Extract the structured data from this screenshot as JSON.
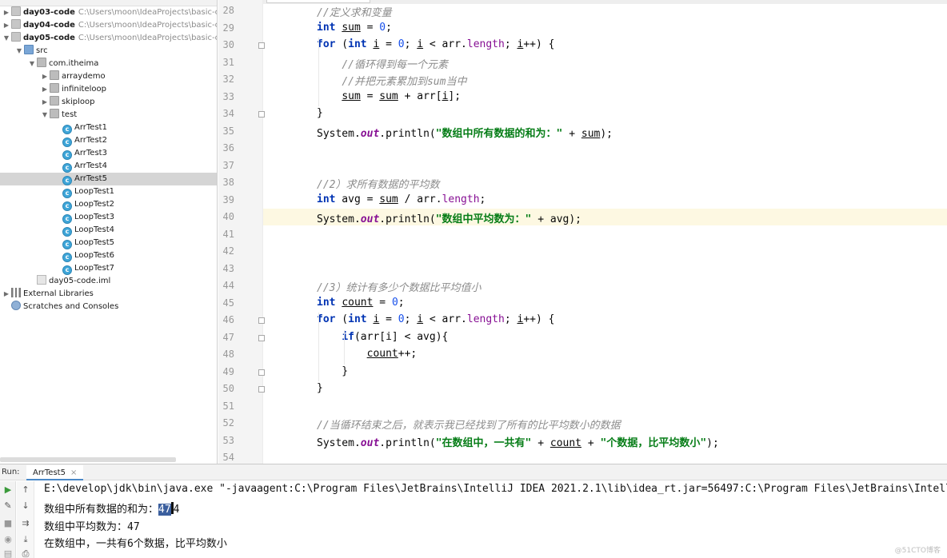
{
  "tree": {
    "rows": [
      {
        "label": "day03-code",
        "path": "C:\\Users\\moon\\IdeaProjects\\basic-code",
        "indent": 0,
        "arrow": "▶",
        "icon": "folder",
        "bold": true
      },
      {
        "label": "day04-code",
        "path": "C:\\Users\\moon\\IdeaProjects\\basic-code",
        "indent": 0,
        "arrow": "▶",
        "icon": "folder",
        "bold": true
      },
      {
        "label": "day05-code",
        "path": "C:\\Users\\moon\\IdeaProjects\\basic-code",
        "indent": 0,
        "arrow": "▼",
        "icon": "folder",
        "bold": true
      },
      {
        "label": "src",
        "path": "",
        "indent": 1,
        "arrow": "▼",
        "icon": "srcfolder",
        "bold": false
      },
      {
        "label": "com.itheima",
        "path": "",
        "indent": 2,
        "arrow": "▼",
        "icon": "pkg",
        "bold": false
      },
      {
        "label": "arraydemo",
        "path": "",
        "indent": 3,
        "arrow": "▶",
        "icon": "pkg",
        "bold": false
      },
      {
        "label": "infiniteloop",
        "path": "",
        "indent": 3,
        "arrow": "▶",
        "icon": "pkg",
        "bold": false
      },
      {
        "label": "skiploop",
        "path": "",
        "indent": 3,
        "arrow": "▶",
        "icon": "pkg",
        "bold": false
      },
      {
        "label": "test",
        "path": "",
        "indent": 3,
        "arrow": "▼",
        "icon": "pkg",
        "bold": false
      },
      {
        "label": "ArrTest1",
        "path": "",
        "indent": 4,
        "arrow": "",
        "icon": "cls",
        "bold": false
      },
      {
        "label": "ArrTest2",
        "path": "",
        "indent": 4,
        "arrow": "",
        "icon": "cls",
        "bold": false
      },
      {
        "label": "ArrTest3",
        "path": "",
        "indent": 4,
        "arrow": "",
        "icon": "cls",
        "bold": false
      },
      {
        "label": "ArrTest4",
        "path": "",
        "indent": 4,
        "arrow": "",
        "icon": "cls",
        "bold": false
      },
      {
        "label": "ArrTest5",
        "path": "",
        "indent": 4,
        "arrow": "",
        "icon": "cls",
        "bold": false,
        "selected": true
      },
      {
        "label": "LoopTest1",
        "path": "",
        "indent": 4,
        "arrow": "",
        "icon": "cls",
        "bold": false
      },
      {
        "label": "LoopTest2",
        "path": "",
        "indent": 4,
        "arrow": "",
        "icon": "cls",
        "bold": false
      },
      {
        "label": "LoopTest3",
        "path": "",
        "indent": 4,
        "arrow": "",
        "icon": "cls",
        "bold": false
      },
      {
        "label": "LoopTest4",
        "path": "",
        "indent": 4,
        "arrow": "",
        "icon": "cls",
        "bold": false
      },
      {
        "label": "LoopTest5",
        "path": "",
        "indent": 4,
        "arrow": "",
        "icon": "cls",
        "bold": false
      },
      {
        "label": "LoopTest6",
        "path": "",
        "indent": 4,
        "arrow": "",
        "icon": "cls",
        "bold": false
      },
      {
        "label": "LoopTest7",
        "path": "",
        "indent": 4,
        "arrow": "",
        "icon": "cls",
        "bold": false
      },
      {
        "label": "day05-code.iml",
        "path": "",
        "indent": 2,
        "arrow": "",
        "icon": "iml",
        "bold": false
      },
      {
        "label": "External Libraries",
        "path": "",
        "indent": 0,
        "arrow": "▶",
        "icon": "lib",
        "bold": false
      },
      {
        "label": "Scratches and Consoles",
        "path": "",
        "indent": 0,
        "arrow": "",
        "icon": "scratch",
        "bold": false
      }
    ]
  },
  "editor": {
    "current_line": 40,
    "lines": [
      {
        "n": 28,
        "code": [
          {
            "t": "//定义求和变量",
            "c": "cm"
          }
        ]
      },
      {
        "n": 29,
        "code": [
          {
            "t": "int",
            "c": "kw"
          },
          {
            "t": " "
          },
          {
            "t": "sum",
            "c": "ul"
          },
          {
            "t": " = "
          },
          {
            "t": "0",
            "c": "num"
          },
          {
            "t": ";"
          }
        ]
      },
      {
        "n": 30,
        "code": [
          {
            "t": "for",
            "c": "kw"
          },
          {
            "t": " ("
          },
          {
            "t": "int",
            "c": "kw"
          },
          {
            "t": " "
          },
          {
            "t": "i",
            "c": "ul"
          },
          {
            "t": " = "
          },
          {
            "t": "0",
            "c": "num"
          },
          {
            "t": "; "
          },
          {
            "t": "i",
            "c": "ul"
          },
          {
            "t": " < arr."
          },
          {
            "t": "length",
            "c": "fld"
          },
          {
            "t": "; "
          },
          {
            "t": "i",
            "c": "ul"
          },
          {
            "t": "++) {"
          }
        ]
      },
      {
        "n": 31,
        "code": [
          {
            "t": "    "
          },
          {
            "t": "//循环得到每一个元素",
            "c": "cm"
          }
        ]
      },
      {
        "n": 32,
        "code": [
          {
            "t": "    "
          },
          {
            "t": "//并把元素累加到sum当中",
            "c": "cm"
          }
        ]
      },
      {
        "n": 33,
        "code": [
          {
            "t": "    "
          },
          {
            "t": "sum",
            "c": "ul"
          },
          {
            "t": " = "
          },
          {
            "t": "sum",
            "c": "ul"
          },
          {
            "t": " + arr["
          },
          {
            "t": "i",
            "c": "ul"
          },
          {
            "t": "];"
          }
        ]
      },
      {
        "n": 34,
        "code": [
          {
            "t": "}"
          }
        ]
      },
      {
        "n": 35,
        "code": [
          {
            "t": "System."
          },
          {
            "t": "out",
            "c": "sfld"
          },
          {
            "t": ".println("
          },
          {
            "t": "\"数组中所有数据的和为：\"",
            "c": "str"
          },
          {
            "t": " + "
          },
          {
            "t": "sum",
            "c": "ul"
          },
          {
            "t": ");"
          }
        ]
      },
      {
        "n": 36,
        "code": []
      },
      {
        "n": 37,
        "code": []
      },
      {
        "n": 38,
        "code": [
          {
            "t": "//2）求所有数据的平均数",
            "c": "cm"
          }
        ]
      },
      {
        "n": 39,
        "code": [
          {
            "t": "int",
            "c": "kw"
          },
          {
            "t": " avg = "
          },
          {
            "t": "sum",
            "c": "ul"
          },
          {
            "t": " / arr."
          },
          {
            "t": "length",
            "c": "fld"
          },
          {
            "t": ";"
          }
        ]
      },
      {
        "n": 40,
        "code": [
          {
            "t": "System."
          },
          {
            "t": "out",
            "c": "sfld"
          },
          {
            "t": ".println("
          },
          {
            "t": "\"数组中平均数为：\"",
            "c": "str"
          },
          {
            "t": " + avg);"
          }
        ]
      },
      {
        "n": 41,
        "code": []
      },
      {
        "n": 42,
        "code": []
      },
      {
        "n": 43,
        "code": []
      },
      {
        "n": 44,
        "code": [
          {
            "t": "//3）统计有多少个数据比平均值小",
            "c": "cm"
          }
        ]
      },
      {
        "n": 45,
        "code": [
          {
            "t": "int",
            "c": "kw"
          },
          {
            "t": " "
          },
          {
            "t": "count",
            "c": "ul"
          },
          {
            "t": " = "
          },
          {
            "t": "0",
            "c": "num"
          },
          {
            "t": ";"
          }
        ]
      },
      {
        "n": 46,
        "code": [
          {
            "t": "for",
            "c": "kw"
          },
          {
            "t": " ("
          },
          {
            "t": "int",
            "c": "kw"
          },
          {
            "t": " "
          },
          {
            "t": "i",
            "c": "ul"
          },
          {
            "t": " = "
          },
          {
            "t": "0",
            "c": "num"
          },
          {
            "t": "; "
          },
          {
            "t": "i",
            "c": "ul"
          },
          {
            "t": " < arr."
          },
          {
            "t": "length",
            "c": "fld"
          },
          {
            "t": "; "
          },
          {
            "t": "i",
            "c": "ul"
          },
          {
            "t": "++) {"
          }
        ]
      },
      {
        "n": 47,
        "code": [
          {
            "t": "    "
          },
          {
            "t": "if",
            "c": "kw"
          },
          {
            "t": "(arr[i] < avg){"
          }
        ]
      },
      {
        "n": 48,
        "code": [
          {
            "t": "        "
          },
          {
            "t": "count",
            "c": "ul"
          },
          {
            "t": "++;"
          }
        ]
      },
      {
        "n": 49,
        "code": [
          {
            "t": "    }"
          }
        ]
      },
      {
        "n": 50,
        "code": [
          {
            "t": "}"
          }
        ]
      },
      {
        "n": 51,
        "code": []
      },
      {
        "n": 52,
        "code": [
          {
            "t": "//当循环结束之后，就表示我已经找到了所有的比平均数小的数据",
            "c": "cm"
          }
        ]
      },
      {
        "n": 53,
        "code": [
          {
            "t": "System."
          },
          {
            "t": "out",
            "c": "sfld"
          },
          {
            "t": ".println("
          },
          {
            "t": "\"在数组中，一共有\"",
            "c": "str"
          },
          {
            "t": " + "
          },
          {
            "t": "count",
            "c": "ul"
          },
          {
            "t": " + "
          },
          {
            "t": "\"个数据，比平均数小\"",
            "c": "str"
          },
          {
            "t": ");"
          }
        ]
      },
      {
        "n": 54,
        "code": []
      }
    ]
  },
  "run": {
    "label": "Run:",
    "tab": "ArrTest5",
    "tab_close": "×",
    "command": "E:\\develop\\jdk\\bin\\java.exe \"-javaagent:C:\\Program Files\\JetBrains\\IntelliJ IDEA 2021.2.1\\lib\\idea_rt.jar=56497:C:\\Program Files\\JetBrains\\IntelliJ",
    "out1_prefix": "数组中所有数据的和为：",
    "out1_selected": "47",
    "out1_suffix": "4",
    "out2": "数组中平均数为：47",
    "out3": "在数组中，一共有6个数据，比平均数小"
  },
  "watermark": "@51CTO博客",
  "colors": {
    "keyword": "#0033b3",
    "string": "#067d17",
    "comment": "#8c8c8c",
    "number": "#1750eb",
    "field": "#871094",
    "current_line_bg": "#fdf8e2",
    "selection": "#3b5f9e"
  }
}
